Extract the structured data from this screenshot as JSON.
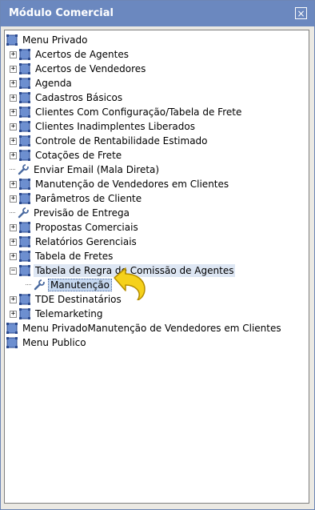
{
  "window": {
    "title": "Módulo Comercial",
    "close_label": "×"
  },
  "tree": {
    "root": {
      "label": "Menu Privado",
      "expanded": true
    },
    "items": [
      {
        "label": "Acertos de Agentes",
        "icon": "folder-icon",
        "expander": "+"
      },
      {
        "label": "Acertos de Vendedores",
        "icon": "folder-icon",
        "expander": "+"
      },
      {
        "label": "Agenda",
        "icon": "folder-icon",
        "expander": "+"
      },
      {
        "label": "Cadastros Básicos",
        "icon": "folder-icon",
        "expander": "+"
      },
      {
        "label": "Clientes Com Configuração/Tabela de Frete",
        "icon": "folder-icon",
        "expander": "+"
      },
      {
        "label": "Clientes Inadimplentes Liberados",
        "icon": "folder-icon",
        "expander": "+"
      },
      {
        "label": "Controle de Rentabilidade Estimado",
        "icon": "folder-icon",
        "expander": "+"
      },
      {
        "label": "Cotações de Frete",
        "icon": "folder-icon",
        "expander": "+"
      },
      {
        "label": "Enviar Email (Mala Direta)",
        "icon": "wrench-icon",
        "expander": ""
      },
      {
        "label": "Manutenção de Vendedores em Clientes",
        "icon": "folder-icon",
        "expander": "+"
      },
      {
        "label": "Parâmetros de Cliente",
        "icon": "folder-icon",
        "expander": "+"
      },
      {
        "label": "Previsão de Entrega",
        "icon": "wrench-icon",
        "expander": ""
      },
      {
        "label": "Propostas Comerciais",
        "icon": "folder-icon",
        "expander": "+"
      },
      {
        "label": "Relatórios Gerenciais",
        "icon": "folder-icon",
        "expander": "+"
      },
      {
        "label": "Tabela de Fretes",
        "icon": "folder-icon",
        "expander": "+"
      },
      {
        "label": "Tabela de Regra de Comissão de Agentes",
        "icon": "folder-icon",
        "expander": "−",
        "expanded": true
      },
      {
        "label": "Manutenção",
        "icon": "wrench-icon",
        "expander": "",
        "child": true,
        "selected": true
      },
      {
        "label": "TDE Destinatários",
        "icon": "folder-icon",
        "expander": "+"
      },
      {
        "label": "Telemarketing",
        "icon": "folder-icon",
        "expander": "+"
      }
    ],
    "top_level": [
      {
        "label": "Menu PrivadoManutenção de Vendedores em Clientes"
      },
      {
        "label": "Menu Publico"
      }
    ]
  },
  "colors": {
    "titlebar": "#6b88bf",
    "folder": "#3a5fa8",
    "selected": "#c5d7ef",
    "arrow": "#f5d11b"
  }
}
